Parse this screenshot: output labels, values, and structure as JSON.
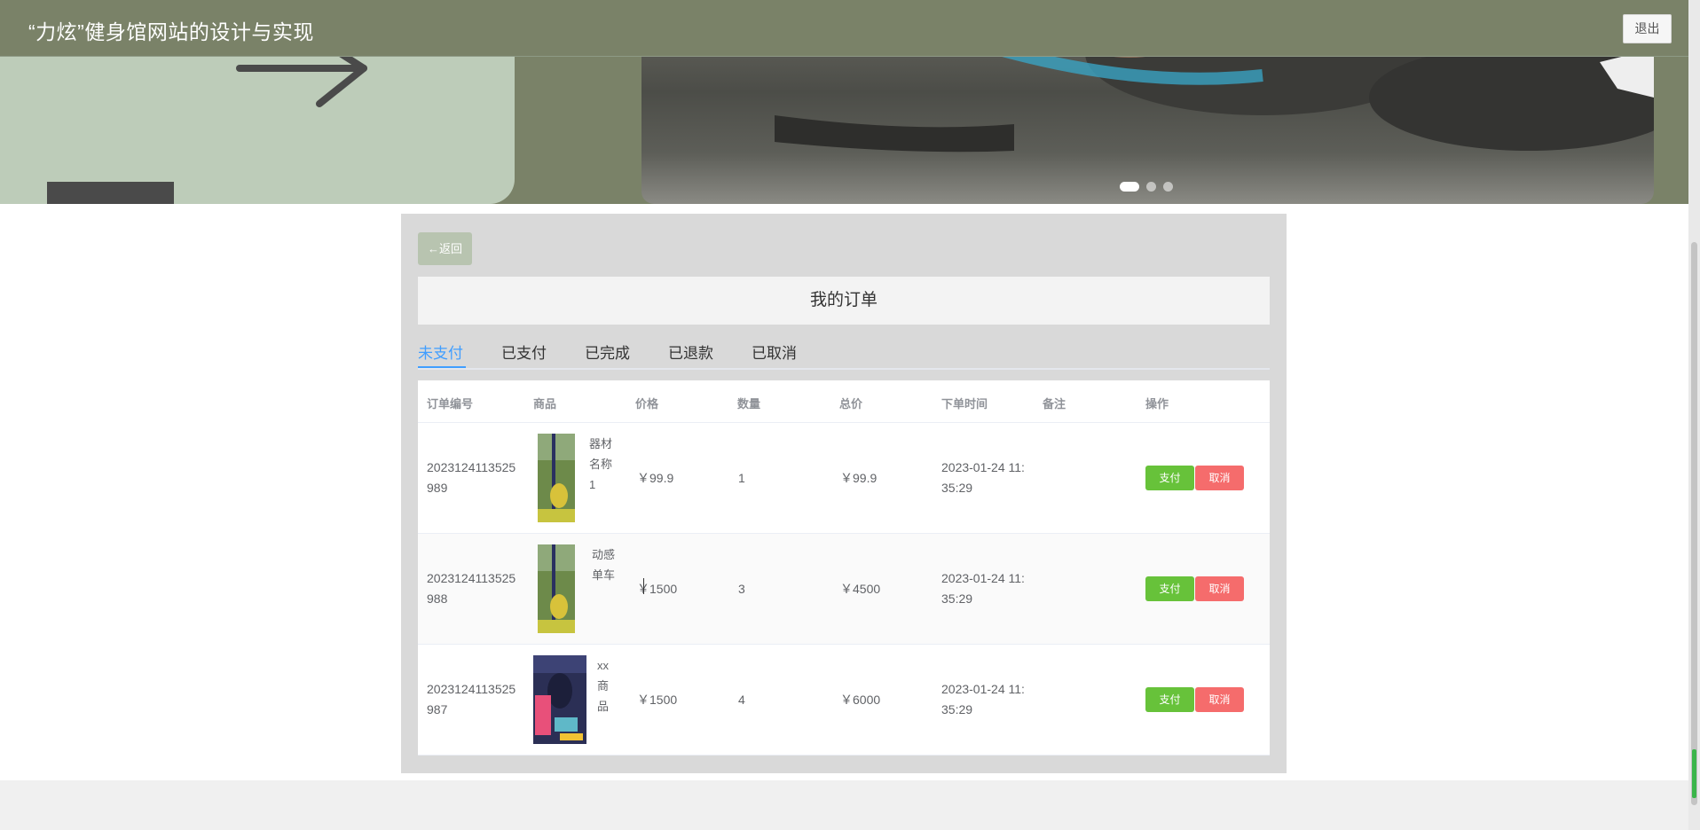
{
  "header": {
    "title": "“力炫”健身馆网站的设计与实现",
    "logout_label": "退出"
  },
  "carousel": {
    "slide_count": 3,
    "active_index": 0
  },
  "orders_page": {
    "back_label": "←返回",
    "title": "我的订单",
    "tabs": [
      {
        "label": "未支付",
        "active": true
      },
      {
        "label": "已支付",
        "active": false
      },
      {
        "label": "已完成",
        "active": false
      },
      {
        "label": "已退款",
        "active": false
      },
      {
        "label": "已取消",
        "active": false
      }
    ],
    "columns": [
      "订单编号",
      "商品",
      "价格",
      "数量",
      "总价",
      "下单时间",
      "备注",
      "操作"
    ],
    "rows": [
      {
        "order_no": "2023124113525989",
        "product": "器材名称1",
        "price": "￥99.9",
        "qty": "1",
        "total": "￥99.9",
        "time": "2023-01-24 11:35:29",
        "note": "",
        "pay": "支付",
        "cancel": "取消"
      },
      {
        "order_no": "2023124113525988",
        "product": "动感单车",
        "price": "￥1500",
        "qty": "3",
        "total": "￥4500",
        "time": "2023-01-24 11:35:29",
        "note": "",
        "pay": "支付",
        "cancel": "取消"
      },
      {
        "order_no": "2023124113525987",
        "product": "xx商品",
        "price": "￥1500",
        "qty": "4",
        "total": "￥6000",
        "time": "2023-01-24 11:35:29",
        "note": "",
        "pay": "支付",
        "cancel": "取消"
      }
    ]
  },
  "colors": {
    "header_bg": "#7a8268",
    "accent": "#409eff",
    "pay": "#67c23a",
    "cancel": "#f56c6c"
  }
}
